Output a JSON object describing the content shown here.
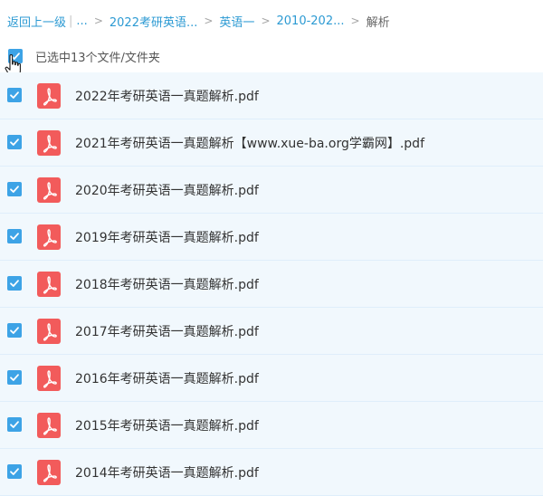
{
  "breadcrumb": {
    "back": "返回上一级",
    "ellipsis": "...",
    "items": [
      "2022考研英语...",
      "英语一",
      "2010-202..."
    ],
    "current": "解析"
  },
  "selection": {
    "text": "已选中13个文件/文件夹"
  },
  "files": [
    {
      "name": "2022年考研英语一真题解析.pdf",
      "icon": "pdf-icon",
      "checked": true
    },
    {
      "name": "2021年考研英语一真题解析【www.xue-ba.org学霸网】.pdf",
      "icon": "pdf-icon",
      "checked": true
    },
    {
      "name": "2020年考研英语一真题解析.pdf",
      "icon": "pdf-icon",
      "checked": true
    },
    {
      "name": "2019年考研英语一真题解析.pdf",
      "icon": "pdf-icon",
      "checked": true
    },
    {
      "name": "2018年考研英语一真题解析.pdf",
      "icon": "pdf-icon",
      "checked": true
    },
    {
      "name": "2017年考研英语一真题解析.pdf",
      "icon": "pdf-icon",
      "checked": true
    },
    {
      "name": "2016年考研英语一真题解析.pdf",
      "icon": "pdf-icon",
      "checked": true
    },
    {
      "name": "2015年考研英语一真题解析.pdf",
      "icon": "pdf-icon",
      "checked": true
    },
    {
      "name": "2014年考研英语一真题解析.pdf",
      "icon": "pdf-icon",
      "checked": true
    }
  ],
  "colors": {
    "link": "#2c9ad3",
    "checkbox": "#3da3e6",
    "row_bg": "#f1f8fd",
    "pdf_red": "#f25b5b"
  }
}
